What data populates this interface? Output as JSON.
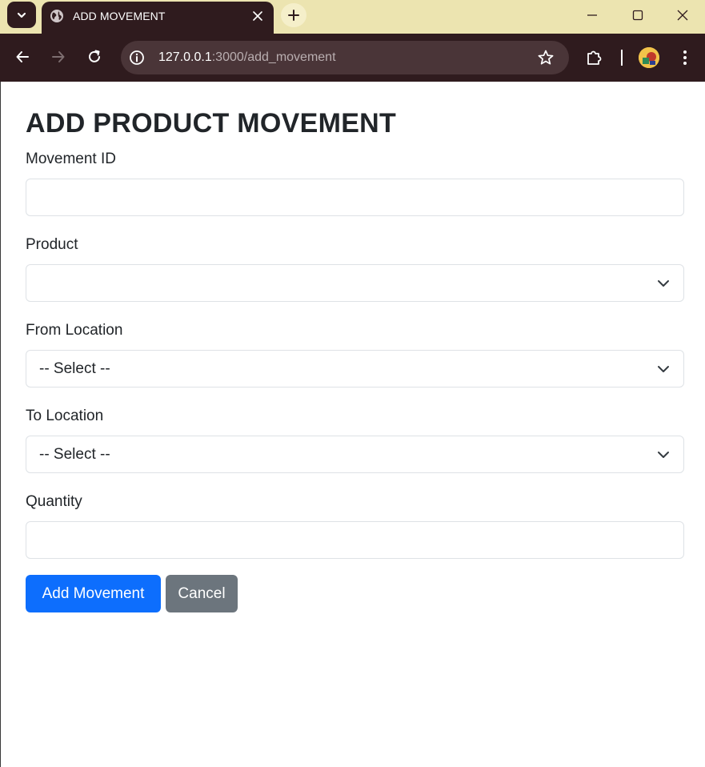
{
  "browser": {
    "tab_title": "ADD MOVEMENT",
    "url_host": "127.0.0.1",
    "url_path": ":3000/add_movement",
    "icons": {
      "tab_menu": "chevron-down-icon",
      "favicon": "globe-icon",
      "tab_close": "close-icon",
      "new_tab": "plus-icon",
      "minimize": "minimize-icon",
      "maximize": "maximize-icon",
      "close_window": "close-icon",
      "back": "arrow-left-icon",
      "forward": "arrow-right-icon",
      "reload": "reload-icon",
      "site_info": "info-icon",
      "bookmark": "star-icon",
      "extensions": "puzzle-icon",
      "profile": "avatar",
      "menu": "kebab-icon"
    },
    "colors": {
      "tabbar": "#ece4b0",
      "toolbar": "#2f1b1e",
      "omnibox": "#4a3538"
    }
  },
  "form": {
    "title": "ADD PRODUCT MOVEMENT",
    "movement_id": {
      "label": "Movement ID",
      "value": ""
    },
    "product": {
      "label": "Product",
      "value": ""
    },
    "from_location": {
      "label": "From Location",
      "value": "-- Select --"
    },
    "to_location": {
      "label": "To Location",
      "value": "-- Select --"
    },
    "quantity": {
      "label": "Quantity",
      "value": ""
    },
    "submit_label": "Add Movement",
    "cancel_label": "Cancel",
    "colors": {
      "primary": "#0d6efd",
      "secondary": "#6c757d",
      "text": "#212529",
      "border": "#dee2e6"
    }
  }
}
